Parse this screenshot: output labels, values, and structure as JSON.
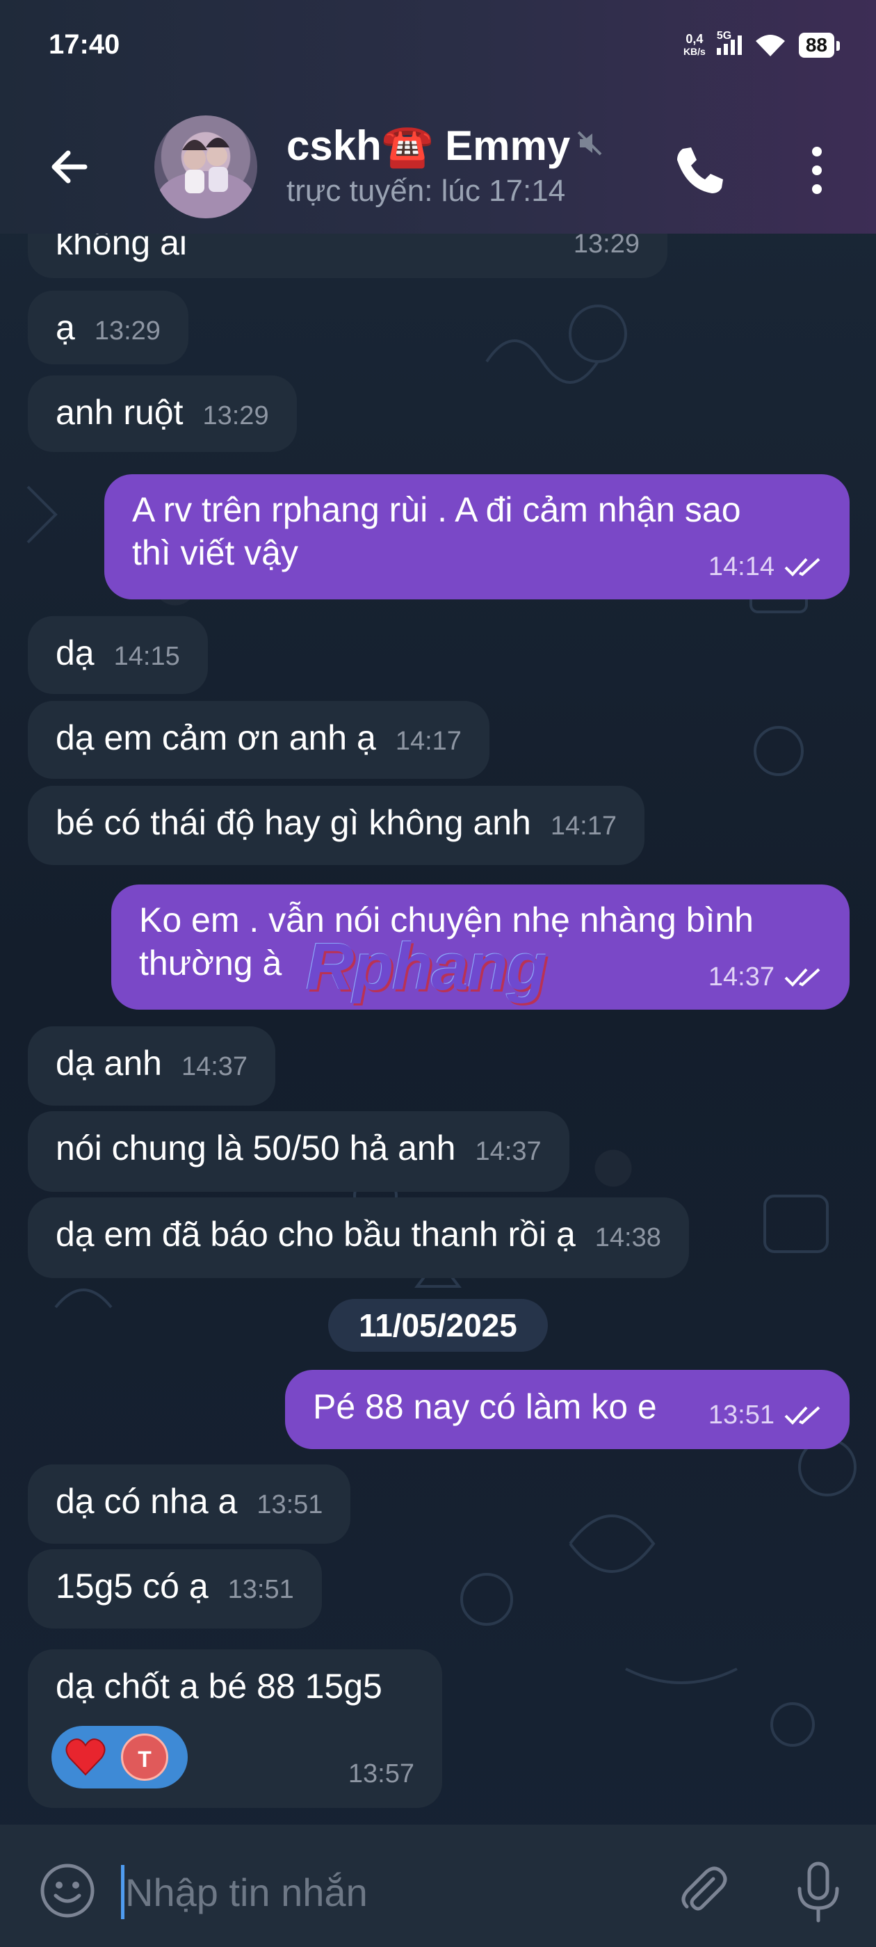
{
  "status_bar": {
    "time": "17:40",
    "net_speed_value": "0,4",
    "net_speed_unit": "KB/s",
    "network": "5G",
    "battery": "88"
  },
  "header": {
    "contact_name": "cskh☎️ Emmy",
    "contact_status": "trực tuyến: lúc 17:14",
    "icons": [
      "back-arrow-icon",
      "mute-icon",
      "phone-icon",
      "more-vert-icon"
    ]
  },
  "messages": [
    {
      "dir": "in",
      "text": "không ai",
      "time": "13:29"
    },
    {
      "dir": "in",
      "text": "ạ",
      "time": "13:29"
    },
    {
      "dir": "in",
      "text": "anh ruột",
      "time": "13:29"
    },
    {
      "dir": "out",
      "line1": "A rv trên rphang rùi . A đi cảm nhận sao",
      "line2": "thì viết vậy",
      "time": "14:14"
    },
    {
      "dir": "in",
      "text": "dạ",
      "time": "14:15"
    },
    {
      "dir": "in",
      "text": "dạ em cảm ơn anh ạ",
      "time": "14:17"
    },
    {
      "dir": "in",
      "text": "bé có thái độ hay gì không anh",
      "time": "14:17"
    },
    {
      "dir": "out",
      "line1": "Ko em . vẫn nói chuyện nhẹ nhàng bình",
      "line2": "thường à",
      "time": "14:37"
    },
    {
      "dir": "in",
      "text": "dạ anh",
      "time": "14:37"
    },
    {
      "dir": "in",
      "text": "nói chung là 50/50 hả anh",
      "time": "14:37"
    },
    {
      "dir": "in",
      "text": "dạ em đã báo cho bầu thanh rồi ạ",
      "time": "14:38"
    },
    {
      "dir": "out",
      "text": "Pé 88 nay có làm ko e",
      "time": "13:51"
    },
    {
      "dir": "in",
      "text": "dạ có nha a",
      "time": "13:51"
    },
    {
      "dir": "in",
      "text": "15g5 có ạ",
      "time": "13:51"
    },
    {
      "dir": "in",
      "text": "dạ chốt a bé 88 15g5",
      "time": "13:57",
      "reaction": {
        "emoji": "heart-icon",
        "reactor_initial": "T"
      }
    }
  ],
  "date_separator": "11/05/2025",
  "watermark": "Rphang",
  "composer": {
    "placeholder": "Nhập tin nhắn",
    "icons": [
      "emoji-icon",
      "attach-icon",
      "mic-icon"
    ]
  },
  "colors": {
    "incoming_bubble": "#212d3b",
    "outgoing_bubble": "#7a48c7",
    "header_gradient_end": "#3d2d55",
    "reaction_pill": "#3e8ad6"
  }
}
